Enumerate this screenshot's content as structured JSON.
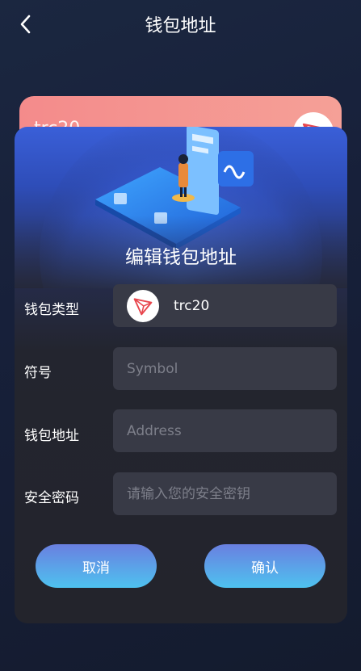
{
  "header": {
    "title": "钱包地址",
    "back_icon": "chevron-left-icon"
  },
  "background_card": {
    "text": "trc20",
    "logo_icon": "tron-logo-icon",
    "color": "#f48b8b"
  },
  "dialog": {
    "title": "编辑钱包地址",
    "wallet_type": {
      "label": "钱包类型",
      "value": "trc20",
      "icon": "tron-logo-icon"
    },
    "symbol": {
      "label": "符号",
      "placeholder": "Symbol",
      "value": ""
    },
    "address": {
      "label": "钱包地址",
      "placeholder": "Address",
      "value": ""
    },
    "password": {
      "label": "安全密码",
      "placeholder": "请输入您的安全密钥",
      "value": ""
    },
    "cancel_label": "取消",
    "confirm_label": "确认"
  },
  "colors": {
    "accent_start": "#6a7fe0",
    "accent_end": "#4ec2ef",
    "tron_red": "#e8464d"
  }
}
